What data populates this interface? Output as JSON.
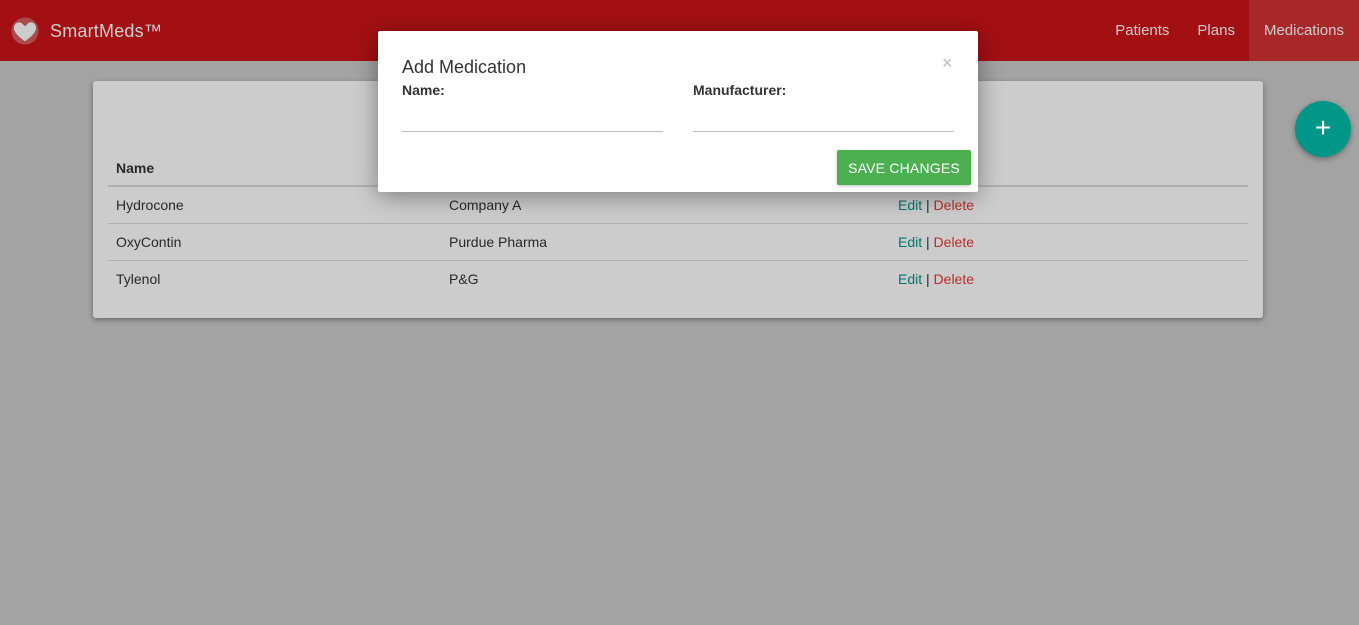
{
  "app": {
    "brand": "SmartMeds™",
    "logo_icon": "heart-icon"
  },
  "nav": [
    {
      "label": "Patients",
      "active": false
    },
    {
      "label": "Plans",
      "active": false
    },
    {
      "label": "Medications",
      "active": true
    }
  ],
  "table": {
    "headers": [
      "Name",
      "",
      ""
    ],
    "rows": [
      {
        "name": "Hydrocone",
        "manufacturer": "Company A",
        "edit": "Edit",
        "sep": "|",
        "delete": "Delete"
      },
      {
        "name": "OxyContin",
        "manufacturer": "Purdue Pharma",
        "edit": "Edit",
        "sep": "|",
        "delete": "Delete"
      },
      {
        "name": "Tylenol",
        "manufacturer": "P&G",
        "edit": "Edit",
        "sep": "|",
        "delete": "Delete"
      }
    ]
  },
  "fab": {
    "icon": "plus-icon",
    "glyph": "+"
  },
  "modal": {
    "title": "Add Medication",
    "close_glyph": "×",
    "name_label": "Name:",
    "name_value": "",
    "manufacturer_label": "Manufacturer:",
    "manufacturer_value": "",
    "save_label": "Save Changes"
  },
  "colors": {
    "navbar": "#cc1518",
    "accent": "#009688",
    "save": "#4caf50",
    "delete": "#e53935"
  }
}
